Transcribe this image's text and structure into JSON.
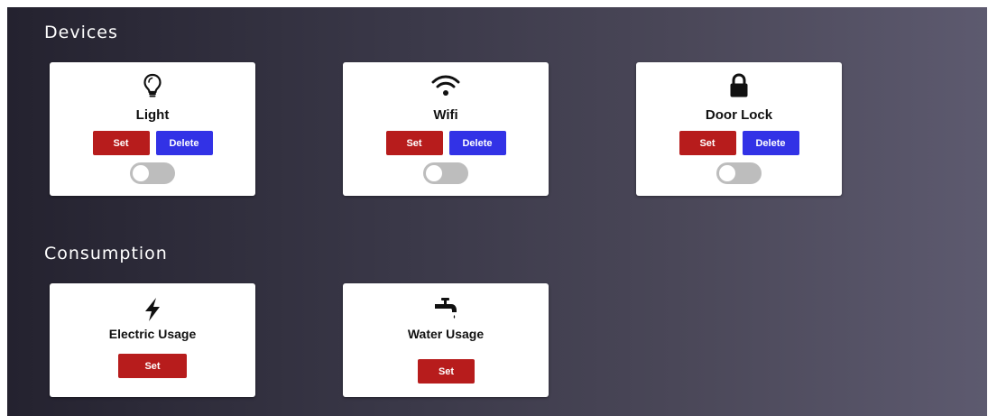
{
  "sections": {
    "devices": {
      "title": "Devices",
      "cards": [
        {
          "label": "Light",
          "icon": "lightbulb-icon",
          "set_label": "Set",
          "delete_label": "Delete",
          "toggle_on": false
        },
        {
          "label": "Wifi",
          "icon": "wifi-icon",
          "set_label": "Set",
          "delete_label": "Delete",
          "toggle_on": false
        },
        {
          "label": "Door Lock",
          "icon": "lock-icon",
          "set_label": "Set",
          "delete_label": "Delete",
          "toggle_on": false
        }
      ]
    },
    "consumption": {
      "title": "Consumption",
      "cards": [
        {
          "label": "Electric Usage",
          "icon": "lightning-bolt-icon",
          "set_label": "Set"
        },
        {
          "label": "Water Usage",
          "icon": "faucet-icon",
          "set_label": "Set"
        }
      ]
    }
  },
  "colors": {
    "set_button": "#b71c1c",
    "delete_button": "#3232e6",
    "toggle_off": "#bdbdbd",
    "panel_start": "#24222f",
    "panel_end": "#5d5a6f"
  }
}
